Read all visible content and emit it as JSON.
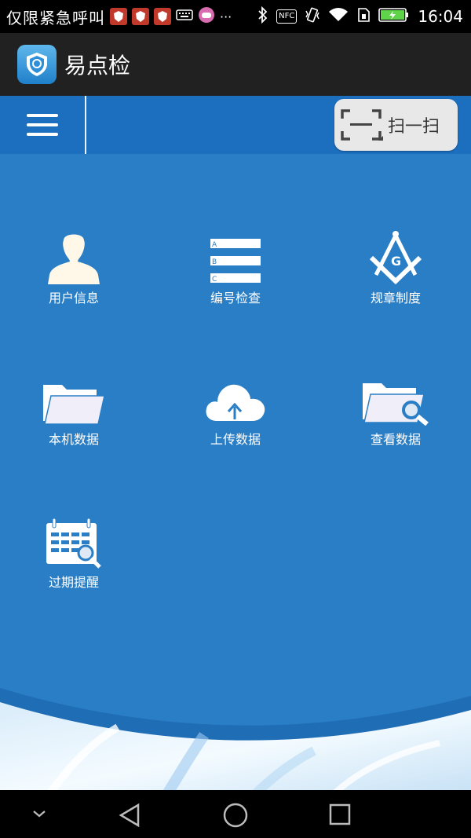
{
  "status_bar": {
    "carrier_text": "仅限紧急呼叫",
    "more": "···",
    "nfc": "NFC",
    "time": "16:04"
  },
  "app_bar": {
    "title": "易点检"
  },
  "toolbar": {
    "scan_label": "扫一扫"
  },
  "grid": [
    {
      "label": "用户信息",
      "icon": "user-icon"
    },
    {
      "label": "编号检查",
      "icon": "abc-list-icon"
    },
    {
      "label": "规章制度",
      "icon": "compass-square-icon"
    },
    {
      "label": "本机数据",
      "icon": "folder-icon"
    },
    {
      "label": "上传数据",
      "icon": "cloud-upload-icon"
    },
    {
      "label": "查看数据",
      "icon": "folder-search-icon"
    },
    {
      "label": "过期提醒",
      "icon": "calendar-search-icon"
    }
  ],
  "list_icon_letters": [
    "A",
    "B",
    "C"
  ],
  "compass_letter": "G",
  "colors": {
    "toolbar": "#1c6fbf",
    "main_bg": "#2a7ec5",
    "app_bar": "#212121"
  }
}
